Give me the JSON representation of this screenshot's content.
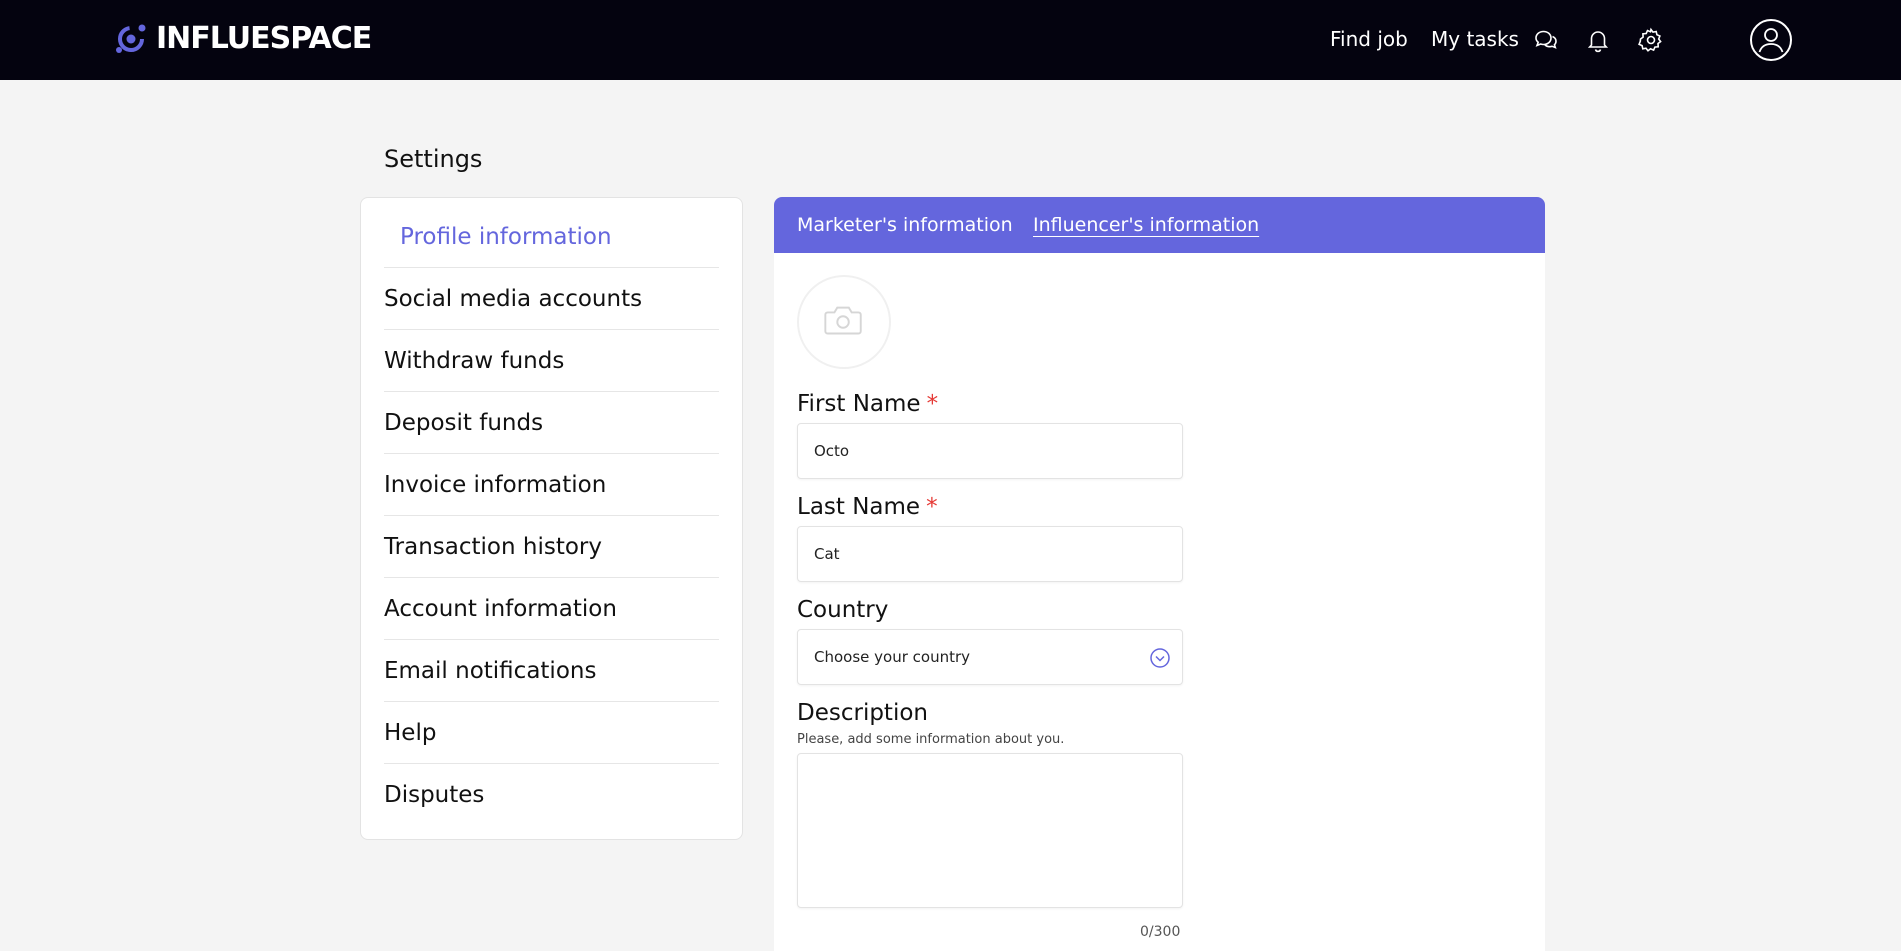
{
  "header": {
    "logo_text": "INFLUESPACE",
    "nav": {
      "find_job": "Find job",
      "my_tasks": "My tasks"
    },
    "icons": [
      "chat-icon",
      "bell-icon",
      "gear-icon",
      "user-icon"
    ]
  },
  "page": {
    "title": "Settings"
  },
  "sidebar": {
    "items": [
      {
        "label": "Profile information",
        "active": true
      },
      {
        "label": "Social media accounts"
      },
      {
        "label": "Withdraw funds"
      },
      {
        "label": "Deposit funds"
      },
      {
        "label": "Invoice information"
      },
      {
        "label": "Transaction history"
      },
      {
        "label": "Account information"
      },
      {
        "label": "Email notifications"
      },
      {
        "label": "Help"
      },
      {
        "label": "Disputes"
      }
    ]
  },
  "tabs": {
    "marketer": "Marketer's information",
    "influencer": "Influencer's information",
    "active": "influencer"
  },
  "form": {
    "first_name": {
      "label": "First Name",
      "required_mark": "*",
      "value": "Octo"
    },
    "last_name": {
      "label": "Last Name",
      "required_mark": "*",
      "value": "Cat"
    },
    "country": {
      "label": "Country",
      "placeholder": "Choose your country"
    },
    "description": {
      "label": "Description",
      "hint": "Please, add some information about you.",
      "value": "",
      "counter": "0/300"
    }
  },
  "colors": {
    "topbar": "#04030f",
    "accent": "#6466dd",
    "required": "#e53935",
    "page_bg": "#f4f4f4"
  }
}
